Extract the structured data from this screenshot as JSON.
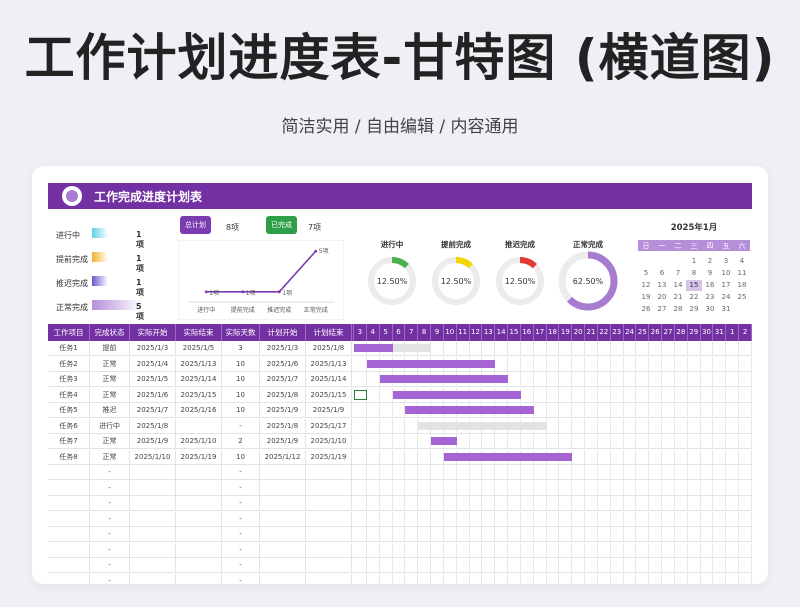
{
  "page": {
    "title": "工作计划进度表-甘特图 (横道图)",
    "subtitle": "简洁实用 / 自由编辑 / 内容通用"
  },
  "sheet": {
    "title": "工作完成进度计划表",
    "accent": "#7230a3"
  },
  "status_legend": [
    {
      "label": "进行中",
      "count": "1项",
      "color": "#5fd0e6",
      "fill": 0.2
    },
    {
      "label": "提前完成",
      "count": "1项",
      "color": "#f0b429",
      "fill": 0.2
    },
    {
      "label": "推迟完成",
      "count": "1项",
      "color": "#6a5acd",
      "fill": 0.2
    },
    {
      "label": "正常完成",
      "count": "5项",
      "color": "#b58fd8",
      "fill": 1.0
    }
  ],
  "summary": {
    "total_label": "总计划",
    "total_value": "8项",
    "done_label": "已完成",
    "done_value": "7项"
  },
  "chart_data": {
    "type": "line",
    "categories": [
      "进行中",
      "提前完成",
      "推迟完成",
      "正常完成"
    ],
    "values": [
      1,
      1,
      1,
      5
    ],
    "data_labels": [
      "1项",
      "1项",
      "1项",
      "5项"
    ],
    "ylim": [
      0,
      5.5
    ],
    "color": "#7a3cb0"
  },
  "donuts": [
    {
      "title": "进行中",
      "label": "12.50%",
      "value": 0.125,
      "color": "#4caf50"
    },
    {
      "title": "提前完成",
      "label": "12.50%",
      "value": 0.125,
      "color": "#f2d600"
    },
    {
      "title": "推迟完成",
      "label": "12.50%",
      "value": 0.125,
      "color": "#e53935"
    },
    {
      "title": "正常完成",
      "label": "62.50%",
      "value": 0.625,
      "color": "#a77cd0"
    }
  ],
  "calendar": {
    "title": "2025年1月",
    "weekdays": [
      "日",
      "一",
      "二",
      "三",
      "四",
      "五",
      "六"
    ],
    "weeks": [
      [
        "",
        "",
        "",
        "1",
        "2",
        "3",
        "4"
      ],
      [
        "5",
        "6",
        "7",
        "8",
        "9",
        "10",
        "11"
      ],
      [
        "12",
        "13",
        "14",
        "15",
        "16",
        "17",
        "18"
      ],
      [
        "19",
        "20",
        "21",
        "22",
        "23",
        "24",
        "25"
      ],
      [
        "26",
        "27",
        "28",
        "29",
        "30",
        "31",
        ""
      ]
    ],
    "today": "15"
  },
  "table": {
    "headers": [
      "工作项目",
      "完成状态",
      "实际开始",
      "实际结束",
      "实际天数",
      "计划开始",
      "计划结束"
    ],
    "days": [
      "3",
      "4",
      "5",
      "6",
      "7",
      "8",
      "9",
      "10",
      "11",
      "12",
      "13",
      "14",
      "15",
      "16",
      "17",
      "18",
      "19",
      "20",
      "21",
      "22",
      "23",
      "24",
      "25",
      "26",
      "27",
      "28",
      "29",
      "30",
      "31",
      "1",
      "2"
    ],
    "rows": [
      {
        "cells": [
          "任务1",
          "提前",
          "2025/1/3",
          "2025/1/5",
          "3",
          "2025/1/3",
          "2025/1/8"
        ],
        "plan": [
          3,
          8
        ],
        "actual": [
          3,
          5
        ]
      },
      {
        "cells": [
          "任务2",
          "正常",
          "2025/1/4",
          "2025/1/13",
          "10",
          "2025/1/6",
          "2025/1/13"
        ],
        "plan": null,
        "actual": [
          4,
          13
        ]
      },
      {
        "cells": [
          "任务3",
          "正常",
          "2025/1/5",
          "2025/1/14",
          "10",
          "2025/1/7",
          "2025/1/14"
        ],
        "plan": null,
        "actual": [
          5,
          14
        ]
      },
      {
        "cells": [
          "任务4",
          "正常",
          "2025/1/6",
          "2025/1/15",
          "10",
          "2025/1/8",
          "2025/1/15"
        ],
        "plan": null,
        "actual": [
          6,
          15
        ]
      },
      {
        "cells": [
          "任务5",
          "推迟",
          "2025/1/7",
          "2025/1/16",
          "10",
          "2025/1/9",
          "2025/1/9"
        ],
        "plan": null,
        "actual": [
          7,
          16
        ]
      },
      {
        "cells": [
          "任务6",
          "进行中",
          "2025/1/8",
          "",
          "-",
          "2025/1/8",
          "2025/1/17"
        ],
        "plan": [
          8,
          17
        ],
        "actual": null
      },
      {
        "cells": [
          "任务7",
          "正常",
          "2025/1/9",
          "2025/1/10",
          "2",
          "2025/1/9",
          "2025/1/10"
        ],
        "plan": null,
        "actual": [
          9,
          10
        ]
      },
      {
        "cells": [
          "任务8",
          "正常",
          "2025/1/10",
          "2025/1/19",
          "10",
          "2025/1/12",
          "2025/1/19"
        ],
        "plan": null,
        "actual": [
          10,
          19
        ]
      },
      {
        "cells": [
          "",
          "-",
          "",
          "",
          "-",
          "",
          ""
        ],
        "plan": null,
        "actual": null
      },
      {
        "cells": [
          "",
          "-",
          "",
          "",
          "-",
          "",
          ""
        ],
        "plan": null,
        "actual": null
      },
      {
        "cells": [
          "",
          "-",
          "",
          "",
          "-",
          "",
          ""
        ],
        "plan": null,
        "actual": null
      },
      {
        "cells": [
          "",
          "-",
          "",
          "",
          "-",
          "",
          ""
        ],
        "plan": null,
        "actual": null
      },
      {
        "cells": [
          "",
          "-",
          "",
          "",
          "-",
          "",
          ""
        ],
        "plan": null,
        "actual": null
      },
      {
        "cells": [
          "",
          "-",
          "",
          "",
          "-",
          "",
          ""
        ],
        "plan": null,
        "actual": null
      },
      {
        "cells": [
          "",
          "-",
          "",
          "",
          "-",
          "",
          ""
        ],
        "plan": null,
        "actual": null
      },
      {
        "cells": [
          "",
          "-",
          "",
          "",
          "-",
          "",
          ""
        ],
        "plan": null,
        "actual": null
      }
    ],
    "bar_color": "#a564d3",
    "plan_color": "#e3e3e3"
  }
}
